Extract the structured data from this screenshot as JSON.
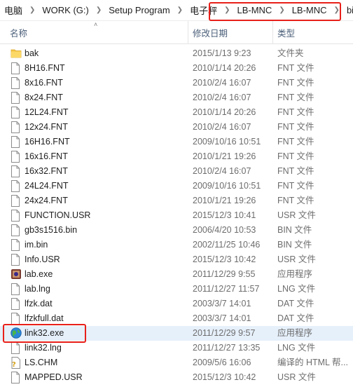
{
  "breadcrumb": [
    {
      "label": "电脑"
    },
    {
      "label": "WORK (G:)"
    },
    {
      "label": "Setup Program"
    },
    {
      "label": "电子秤"
    },
    {
      "label": "LB-MNC"
    },
    {
      "label": "LB-MNC"
    },
    {
      "label": "bin"
    }
  ],
  "columns": {
    "name": "名称",
    "date": "修改日期",
    "type": "类型"
  },
  "files": [
    {
      "name": "bak",
      "date": "2015/1/13 9:23",
      "type": "文件夹",
      "icon": "folder-icon"
    },
    {
      "name": "8H16.FNT",
      "date": "2010/1/14 20:26",
      "type": "FNT 文件",
      "icon": "file-icon"
    },
    {
      "name": "8x16.FNT",
      "date": "2010/2/4 16:07",
      "type": "FNT 文件",
      "icon": "file-icon"
    },
    {
      "name": "8x24.FNT",
      "date": "2010/2/4 16:07",
      "type": "FNT 文件",
      "icon": "file-icon"
    },
    {
      "name": "12L24.FNT",
      "date": "2010/1/14 20:26",
      "type": "FNT 文件",
      "icon": "file-icon"
    },
    {
      "name": "12x24.FNT",
      "date": "2010/2/4 16:07",
      "type": "FNT 文件",
      "icon": "file-icon"
    },
    {
      "name": "16H16.FNT",
      "date": "2009/10/16 10:51",
      "type": "FNT 文件",
      "icon": "file-icon"
    },
    {
      "name": "16x16.FNT",
      "date": "2010/1/21 19:26",
      "type": "FNT 文件",
      "icon": "file-icon"
    },
    {
      "name": "16x32.FNT",
      "date": "2010/2/4 16:07",
      "type": "FNT 文件",
      "icon": "file-icon"
    },
    {
      "name": "24L24.FNT",
      "date": "2009/10/16 10:51",
      "type": "FNT 文件",
      "icon": "file-icon"
    },
    {
      "name": "24x24.FNT",
      "date": "2010/1/21 19:26",
      "type": "FNT 文件",
      "icon": "file-icon"
    },
    {
      "name": "FUNCTION.USR",
      "date": "2015/12/3 10:41",
      "type": "USR 文件",
      "icon": "file-icon"
    },
    {
      "name": "gb3s1516.bin",
      "date": "2006/4/20 10:53",
      "type": "BIN 文件",
      "icon": "file-icon"
    },
    {
      "name": "im.bin",
      "date": "2002/11/25 10:46",
      "type": "BIN 文件",
      "icon": "file-icon"
    },
    {
      "name": "Info.USR",
      "date": "2015/12/3 10:42",
      "type": "USR 文件",
      "icon": "file-icon"
    },
    {
      "name": "lab.exe",
      "date": "2011/12/29 9:55",
      "type": "应用程序",
      "icon": "lab-exe-icon"
    },
    {
      "name": "lab.lng",
      "date": "2011/12/27 11:57",
      "type": "LNG 文件",
      "icon": "file-icon"
    },
    {
      "name": "lfzk.dat",
      "date": "2003/3/7 14:01",
      "type": "DAT 文件",
      "icon": "file-icon"
    },
    {
      "name": "lfzkfull.dat",
      "date": "2003/3/7 14:01",
      "type": "DAT 文件",
      "icon": "file-icon"
    },
    {
      "name": "link32.exe",
      "date": "2011/12/29 9:57",
      "type": "应用程序",
      "icon": "globe-icon",
      "selected": true
    },
    {
      "name": "link32.lng",
      "date": "2011/12/27 13:35",
      "type": "LNG 文件",
      "icon": "file-icon"
    },
    {
      "name": "LS.CHM",
      "date": "2009/5/6 16:06",
      "type": "编译的 HTML 帮...",
      "icon": "help-file-icon"
    },
    {
      "name": "MAPPED.USR",
      "date": "2015/12/3 10:42",
      "type": "USR 文件",
      "icon": "file-icon"
    }
  ],
  "colors": {
    "highlight": "#e8201a",
    "selected_row": "#e6f0fb",
    "header_text": "#4c607a"
  }
}
